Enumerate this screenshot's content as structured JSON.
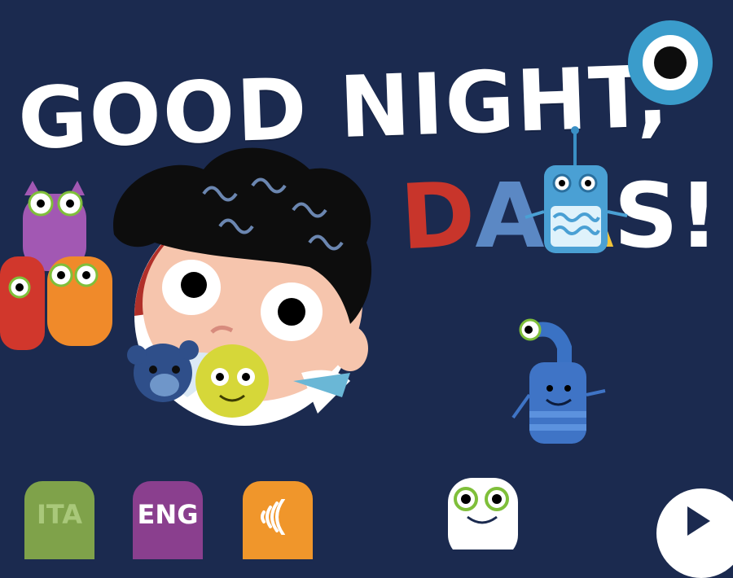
{
  "title": {
    "line1": "GOOD NIGHT,",
    "line2_letters": [
      "D",
      "A",
      "A",
      "S",
      "!"
    ]
  },
  "language_buttons": [
    {
      "label": "ITA",
      "color": "#7fa24a"
    },
    {
      "label": "ENG",
      "color": "#8a3f8e"
    }
  ],
  "audio_button": {
    "icon": "speaker-waves-icon",
    "color": "#f0962b"
  },
  "top_right_button": {
    "icon": "eye-icon",
    "color": "#3a9ccb"
  },
  "bottom_right_button": {
    "icon": "play-icon"
  },
  "colors": {
    "background": "#1b2a4f",
    "title_d": "#c8352b",
    "title_a1": "#5b88c4",
    "title_a2": "#f1c43a"
  }
}
